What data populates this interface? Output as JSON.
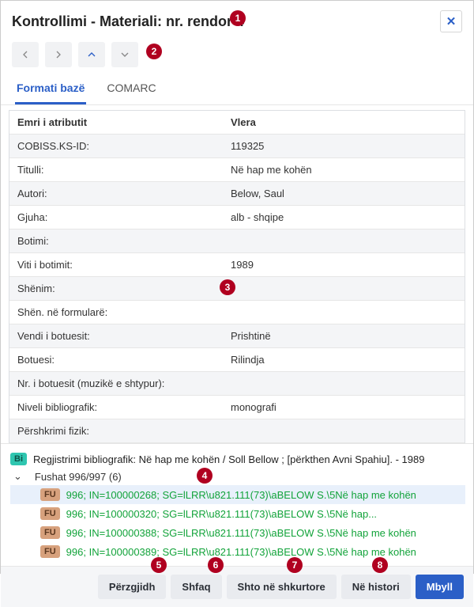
{
  "header": {
    "title": "Kontrollimi - Materiali: nr. rendor 4"
  },
  "tabs": {
    "t0": "Formati bazë",
    "t1": "COMARC"
  },
  "table": {
    "head_name": "Emri i atributit",
    "head_val": "Vlera",
    "rows": [
      {
        "name": "COBISS.KS-ID:",
        "val": "119325"
      },
      {
        "name": "Titulli:",
        "val": "Në hap me kohën"
      },
      {
        "name": "Autori:",
        "val": "Below, Saul"
      },
      {
        "name": "Gjuha:",
        "val": "alb - shqipe"
      },
      {
        "name": "Botimi:",
        "val": ""
      },
      {
        "name": "Viti i botimit:",
        "val": "1989"
      },
      {
        "name": "Shënim:",
        "val": ""
      },
      {
        "name": "Shën. në formularë:",
        "val": ""
      },
      {
        "name": "Vendi i botuesit:",
        "val": "Prishtinë"
      },
      {
        "name": "Botuesi:",
        "val": "Rilindja"
      },
      {
        "name": "Nr. i botuesit (muzikë e shtypur):",
        "val": ""
      },
      {
        "name": "Niveli bibliografik:",
        "val": "monografi"
      },
      {
        "name": "Përshkrimi fizik:",
        "val": ""
      }
    ]
  },
  "detail": {
    "bi_badge": "Bi",
    "bib": "Regjistrimi bibliografik: Në hap me kohën / Soll Bellow ; [përkthen Avni Spahiu]. - 1989",
    "fields_label": "Fushat 996/997 (6)",
    "fu_badge": "FU",
    "fu": [
      "996; IN=100000268; SG=lLRR\\u821.111(73)\\aBELOW S.\\5Në hap me kohën",
      "996; IN=100000320; SG=lLRR\\u821.111(73)\\aBELOW S.\\5Në hap...",
      "996; IN=100000388; SG=lLRR\\u821.111(73)\\aBELOW S.\\5Në hap me kohën",
      "996; IN=100000389; SG=lLRR\\u821.111(73)\\aBELOW S.\\5Në hap me kohën"
    ]
  },
  "footer": {
    "deselect": "Përzgjidh",
    "show": "Shfaq",
    "add_shortcut": "Shto në shkurtore",
    "history": "Në histori",
    "close": "Mbyll"
  },
  "callouts": {
    "c1": "1",
    "c2": "2",
    "c3": "3",
    "c4": "4",
    "c5": "5",
    "c6": "6",
    "c7": "7",
    "c8": "8"
  }
}
